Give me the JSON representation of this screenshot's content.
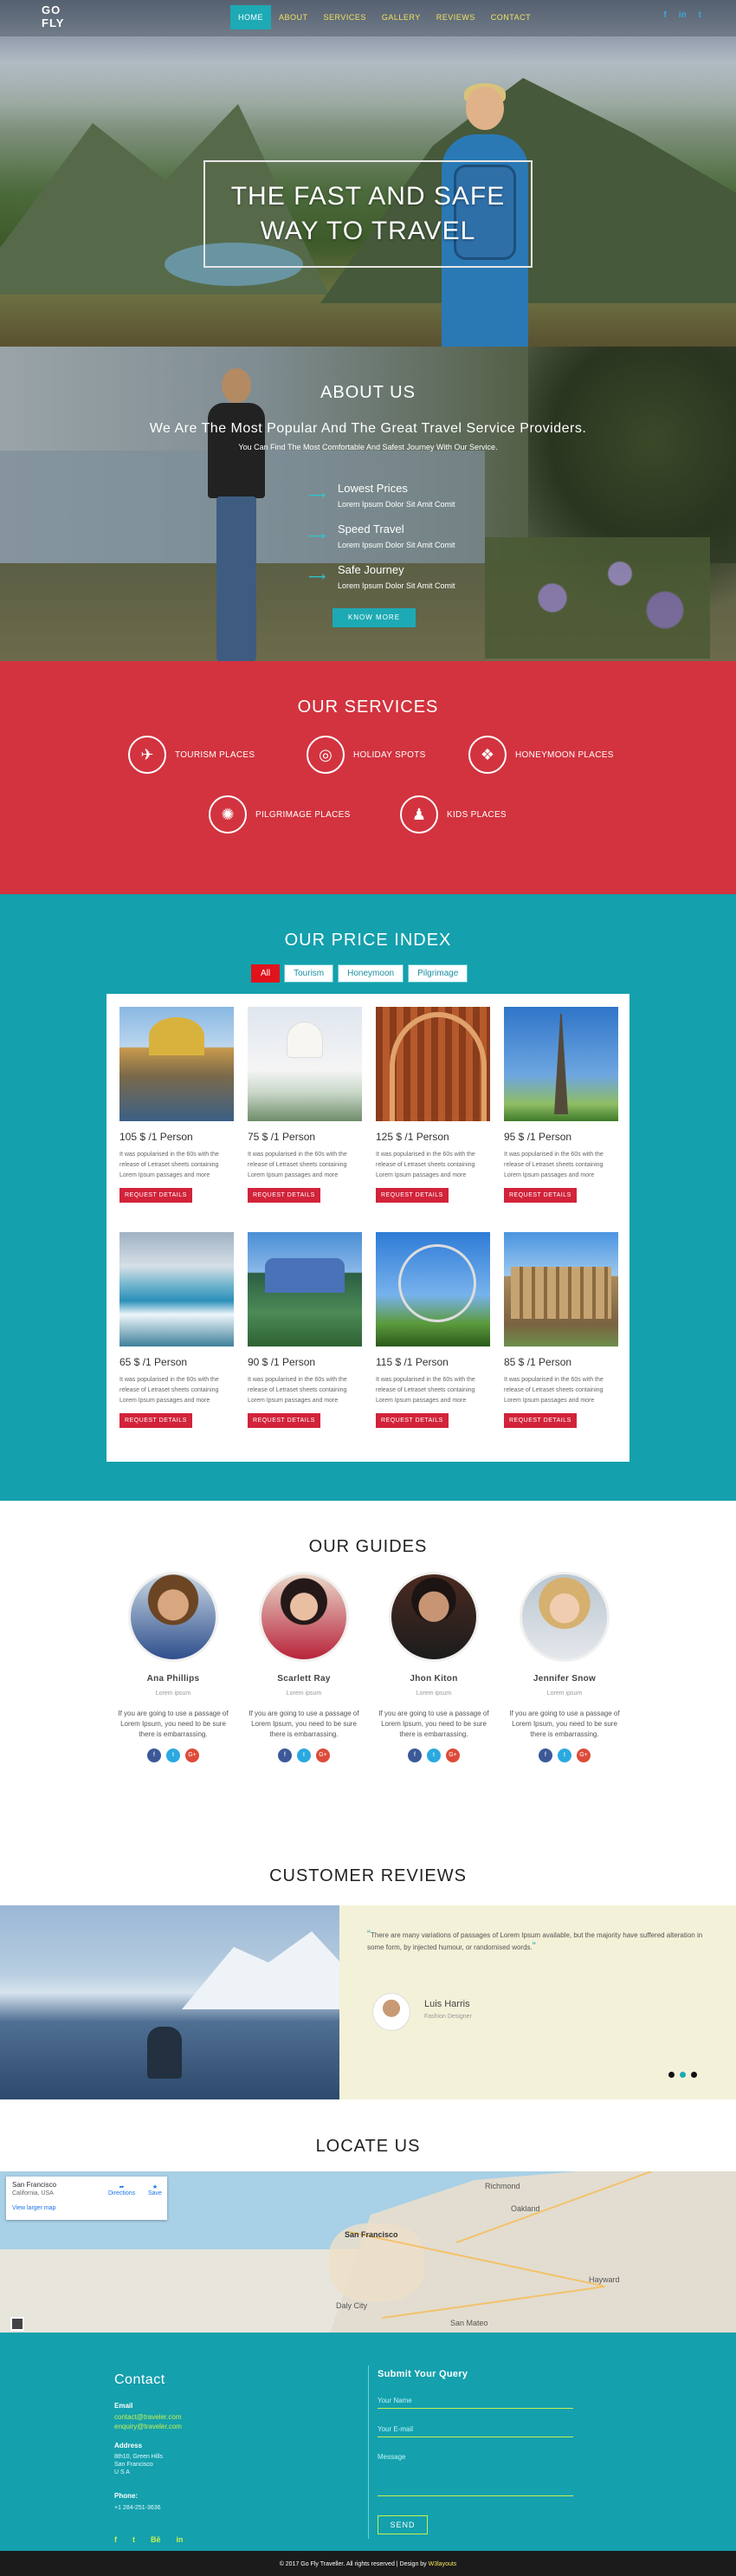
{
  "brand": {
    "line1": "GO",
    "line2": "FLY"
  },
  "nav": {
    "items": [
      "HOME",
      "ABOUT",
      "SERVICES",
      "GALLERY",
      "REVIEWS",
      "CONTACT"
    ],
    "active": "HOME"
  },
  "top_socials": [
    "f",
    "in",
    "t"
  ],
  "hero": {
    "title_line1": "THE FAST AND SAFE",
    "title_line2": "WAY TO TRAVEL"
  },
  "about": {
    "title": "ABOUT US",
    "subtitle": "We Are The Most Popular And The Great Travel Service Providers.",
    "note": "You Can Find The Most Comfortable And Safest Journey With Our Service.",
    "features": [
      {
        "title": "Lowest Prices",
        "desc": "Lorem Ipsum Dolor Sit Amit Comit"
      },
      {
        "title": "Speed Travel",
        "desc": "Lorem Ipsum Dolor Sit Amit Comit"
      },
      {
        "title": "Safe Journey",
        "desc": "Lorem Ipsum Dolor Sit Amit Comit"
      }
    ],
    "button": "KNOW MORE"
  },
  "services": {
    "title": "OUR SERVICES",
    "items": [
      {
        "label": "TOURISM PLACES",
        "icon": "airplane-icon",
        "glyph": "✈"
      },
      {
        "label": "HOLIDAY SPOTS",
        "icon": "binoculars-icon",
        "glyph": "◎"
      },
      {
        "label": "HONEYMOON PLACES",
        "icon": "heart-icon",
        "glyph": "❖"
      },
      {
        "label": "PILGRIMAGE PLACES",
        "icon": "dharma-wheel-icon",
        "glyph": "✺"
      },
      {
        "label": "KIDS PLACES",
        "icon": "chess-pawn-icon",
        "glyph": "♟"
      }
    ]
  },
  "prices": {
    "title": "OUR PRICE INDEX",
    "filters": [
      "All",
      "Tourism",
      "Honeymoon",
      "Pilgrimage"
    ],
    "active_filter": "All",
    "desc": "It was popularised in the 60s with the release of Letraset sheets containing Lorem Ipsum passages and more",
    "button": "REQUEST DETAILS",
    "cards": [
      {
        "price": "105 $ /1 Person",
        "image": "dome-of-the-rock"
      },
      {
        "price": "75 $ /1 Person",
        "image": "taj-mahal"
      },
      {
        "price": "125 $ /1 Person",
        "image": "cathedral-interior"
      },
      {
        "price": "95 $ /1 Person",
        "image": "eiffel-tower"
      },
      {
        "price": "65 $ /1 Person",
        "image": "waterfall"
      },
      {
        "price": "90 $ /1 Person",
        "image": "palace"
      },
      {
        "price": "115 $ /1 Person",
        "image": "london-eye"
      },
      {
        "price": "85 $ /1 Person",
        "image": "colosseum"
      }
    ]
  },
  "guides": {
    "title": "OUR GUIDES",
    "role": "Lorem ipsum",
    "desc": "If you are going to use a passage of Lorem Ipsum, you need to be sure there is embarrassing.",
    "social": [
      "f",
      "t",
      "G+"
    ],
    "people": [
      {
        "name": "Ana Phillips"
      },
      {
        "name": "Scarlett Ray"
      },
      {
        "name": "Jhon Kiton"
      },
      {
        "name": "Jennifer Snow"
      }
    ]
  },
  "reviews": {
    "title": "CUSTOMER REVIEWS",
    "quote": "There are many variations of passages of Lorem Ipsum available, but the majority have suffered alteration in some form, by injected humour, or randomised words.",
    "name": "Luis Harris",
    "role": "Fashion Designer"
  },
  "locate": {
    "title": "LOCATE US",
    "map_place": "San Francisco",
    "map_region": "California, USA",
    "map_link": "View larger map",
    "directions": "Directions",
    "save": "Save",
    "labels": [
      "San Francisco",
      "Oakland",
      "Daly City",
      "San Mateo",
      "Richmond",
      "Hayward"
    ]
  },
  "contact": {
    "title": "Contact",
    "email_label": "Email",
    "emails": [
      "contact@traveler.com",
      "enquiry@traveler.com"
    ],
    "address_label": "Address",
    "address": [
      "8th10, Green Hills",
      "San Francisco",
      "U S A"
    ],
    "phone_label": "Phone:",
    "phone": "+1 284-251-3636",
    "socials": [
      "f",
      "t",
      "Bē",
      "in"
    ],
    "form_title": "Submit Your Query",
    "name_placeholder": "Your Name",
    "email_placeholder": "Your E-mail",
    "message_placeholder": "Message",
    "send": "SEND"
  },
  "footer": {
    "text": "© 2017 Go Fly Traveller. All rights reserved | Design by ",
    "credit": "W3layouts"
  },
  "colors": {
    "teal": "#14a0ad",
    "red": "#d2333f",
    "accent_yellow": "#f2e25e",
    "lime": "#c6f050"
  }
}
